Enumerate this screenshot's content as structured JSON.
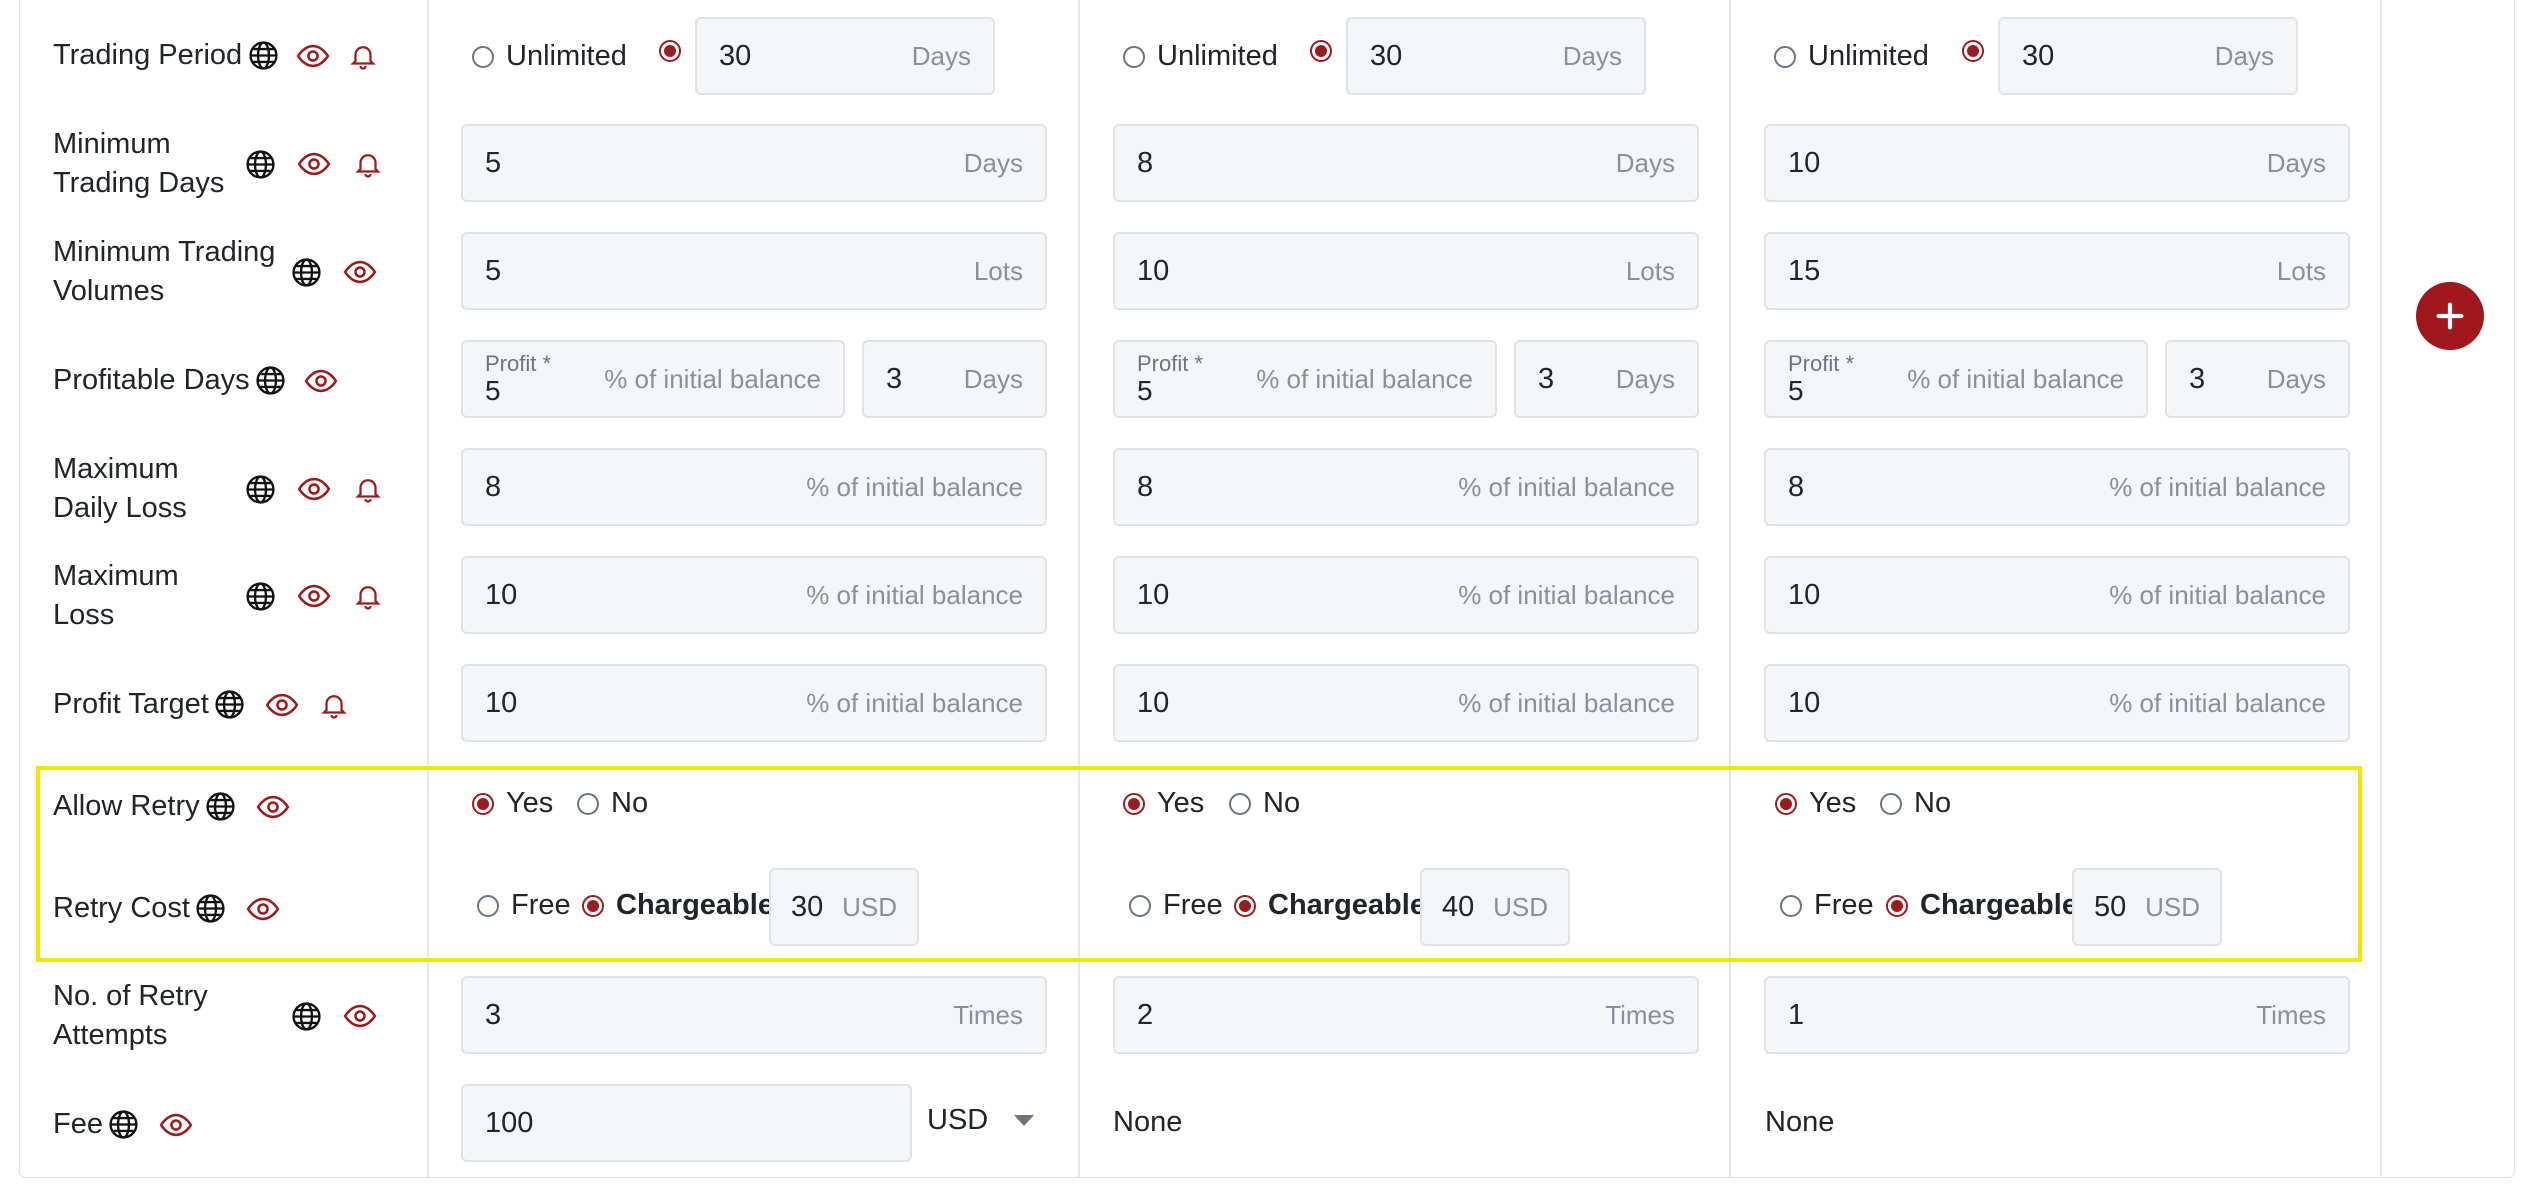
{
  "rows": {
    "trading_period": {
      "label": "Trading Period",
      "options": [
        "Unlimited"
      ],
      "values": [
        "30",
        "30",
        "30"
      ],
      "unit": "Days"
    },
    "min_trading_days": {
      "label": [
        "Minimum",
        "Trading Days"
      ],
      "values": [
        "5",
        "8",
        "10"
      ],
      "unit": "Days"
    },
    "min_trading_volumes": {
      "label": [
        "Minimum Trading",
        "Volumes"
      ],
      "values": [
        "5",
        "10",
        "15"
      ],
      "unit": "Lots"
    },
    "profitable_days": {
      "label": "Profitable Days",
      "profit_label": "Profit *",
      "profit_values": [
        "5",
        "5",
        "5"
      ],
      "profit_unit": "% of initial balance",
      "day_values": [
        "3",
        "3",
        "3"
      ],
      "day_unit": "Days"
    },
    "max_daily_loss": {
      "label": [
        "Maximum",
        "Daily Loss"
      ],
      "values": [
        "8",
        "8",
        "8"
      ],
      "unit": "% of initial balance"
    },
    "max_loss": {
      "label": [
        "Maximum",
        "Loss"
      ],
      "values": [
        "10",
        "10",
        "10"
      ],
      "unit": "% of initial balance"
    },
    "profit_target": {
      "label": "Profit Target",
      "values": [
        "10",
        "10",
        "10"
      ],
      "unit": "% of initial balance"
    },
    "allow_retry": {
      "label": "Allow Retry",
      "yes": "Yes",
      "no": "No"
    },
    "retry_cost": {
      "label": "Retry Cost",
      "free": "Free",
      "chargeable": "Chargeable",
      "values": [
        "30",
        "40",
        "50"
      ],
      "unit": "USD"
    },
    "retry_attempts": {
      "label": [
        "No. of Retry",
        "Attempts"
      ],
      "values": [
        "3",
        "2",
        "1"
      ],
      "unit": "Times"
    },
    "fee": {
      "label": "Fee",
      "value": "100",
      "currency": "USD",
      "none": [
        "None",
        "None"
      ]
    }
  },
  "colors": {
    "accent": "#9b1c1f",
    "highlight": "#f2e600"
  },
  "icons": {
    "globe": "globe-icon",
    "eye": "eye-icon",
    "bell": "bell-icon",
    "add": "plus-icon"
  }
}
